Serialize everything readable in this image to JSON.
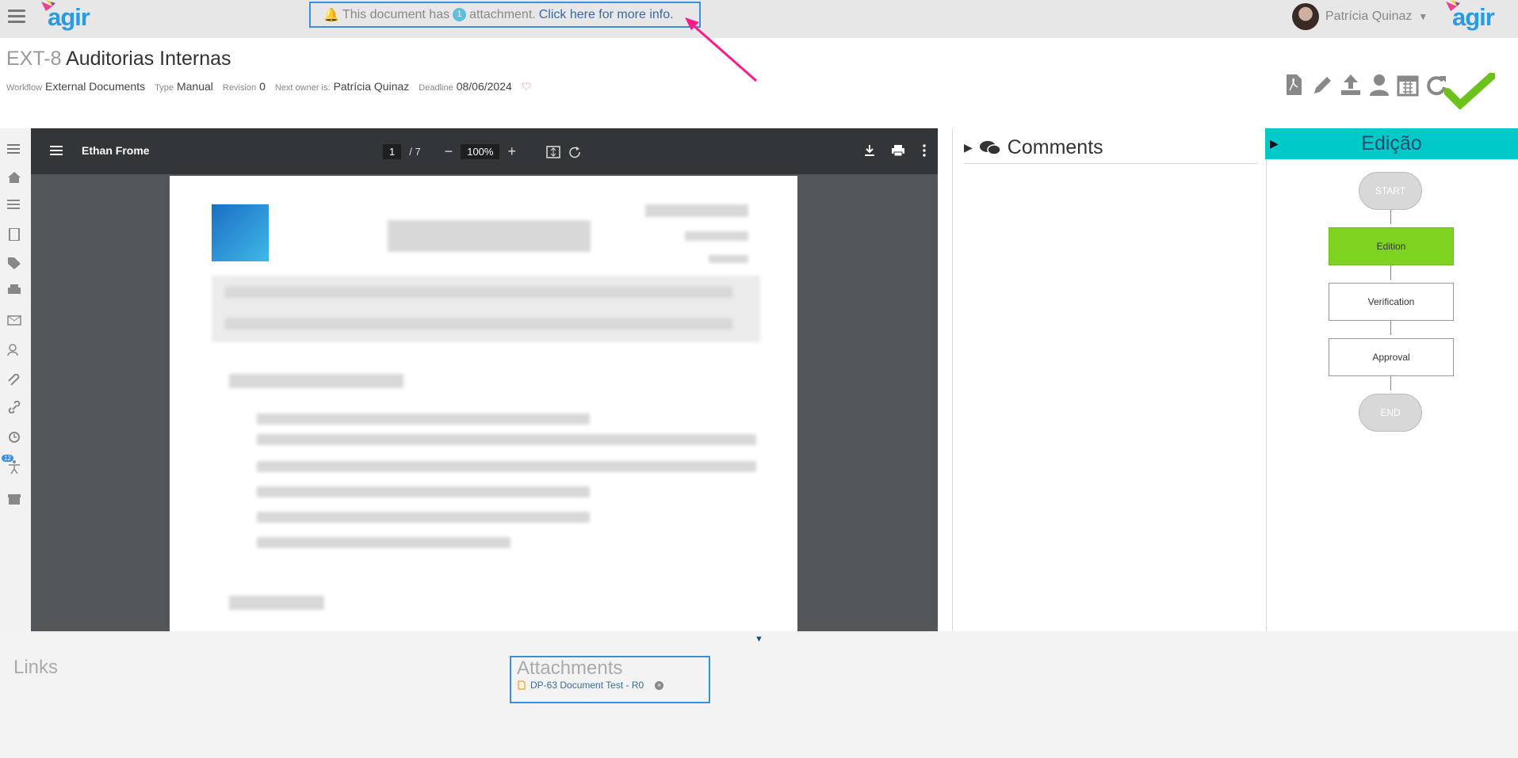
{
  "header": {
    "logo_text": "agir",
    "notice_prefix": "This document has",
    "attachment_count": "1",
    "notice_middle": "attachment.",
    "notice_link": "Click here for more info.",
    "user_name": "Patrícia Quinaz"
  },
  "document": {
    "code": "EXT-8",
    "title": "Auditorias Internas",
    "workflow_label": "Workflow",
    "workflow": "External Documents",
    "type_label": "Type",
    "type": "Manual",
    "revision_label": "Revision",
    "revision": "0",
    "next_owner_label": "Next owner is:",
    "next_owner": "Patrícia Quinaz",
    "deadline_label": "Deadline",
    "deadline": "08/06/2024"
  },
  "left_nav": {
    "badge": "12"
  },
  "viewer": {
    "title": "Ethan Frome",
    "page_current": "1",
    "page_total": "/ 7",
    "zoom": "100%"
  },
  "comments": {
    "heading": "Comments"
  },
  "workflow_panel": {
    "heading": "Edição",
    "nodes": [
      "START",
      "Edition",
      "Verification",
      "Approval",
      "END"
    ],
    "active_node": "Edition",
    "active_color": "#7ed321",
    "header_color": "#00c9c9"
  },
  "bottom": {
    "links_heading": "Links",
    "attachments_heading": "Attachments",
    "attachment_file": "DP-63 Document Test - R0"
  }
}
